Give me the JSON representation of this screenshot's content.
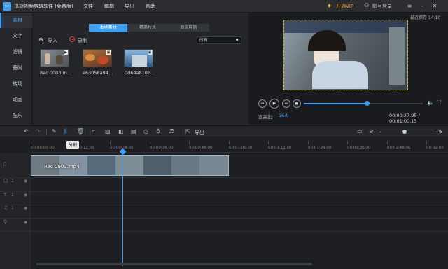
{
  "titlebar": {
    "app_title": "迅捷视频剪辑软件 (免费版)",
    "menu": [
      "文件",
      "编辑",
      "导出",
      "帮助"
    ],
    "vip_label": "开通VIP",
    "login_label": "账号登录"
  },
  "sidebar": {
    "items": [
      {
        "label": "素材",
        "active": true
      },
      {
        "label": "文字"
      },
      {
        "label": "滤镜"
      },
      {
        "label": "叠附"
      },
      {
        "label": "转场"
      },
      {
        "label": "动画"
      },
      {
        "label": "配乐"
      }
    ]
  },
  "media": {
    "tabs": [
      "本地素材",
      "精美片头",
      "背景样例"
    ],
    "filter_value": "所有",
    "import_label": "导入",
    "record_label": "录制",
    "thumbnails": [
      {
        "name": "Rec 0003.m...",
        "color": "#6a6f76"
      },
      {
        "name": "e63058a94...",
        "color": "#8a5a3a"
      },
      {
        "name": "0d64a810b...",
        "color": "#3c6e9e"
      }
    ]
  },
  "preview": {
    "autosave": "最近保存 14:10",
    "ratio_label": "宽高比:",
    "ratio_value": "16:9",
    "time": "00:00:27.95 / 00:01:00.13",
    "progress": 0.53
  },
  "toolbar": {
    "export_label": "导出",
    "tooltip": "分割",
    "zoom": 0.46
  },
  "timeline": {
    "ticks": [
      "00:00:00.00",
      "00:00:12.00",
      "00:00:24.00",
      "00:00:36.00",
      "00:00:48.00",
      "00:01:00.00",
      "00:01:12.00",
      "00:01:24.00",
      "00:01:36.00",
      "00:01:48.00",
      "00:02:00"
    ],
    "clip_label": "Rec 0003.mp4",
    "tracks": [
      {
        "icon": "▯",
        "num": ""
      },
      {
        "icon": "▢",
        "num": "1"
      },
      {
        "icon": "T",
        "num": "1"
      },
      {
        "icon": "♫",
        "num": "1"
      },
      {
        "icon": "🎙",
        "num": ""
      }
    ]
  }
}
